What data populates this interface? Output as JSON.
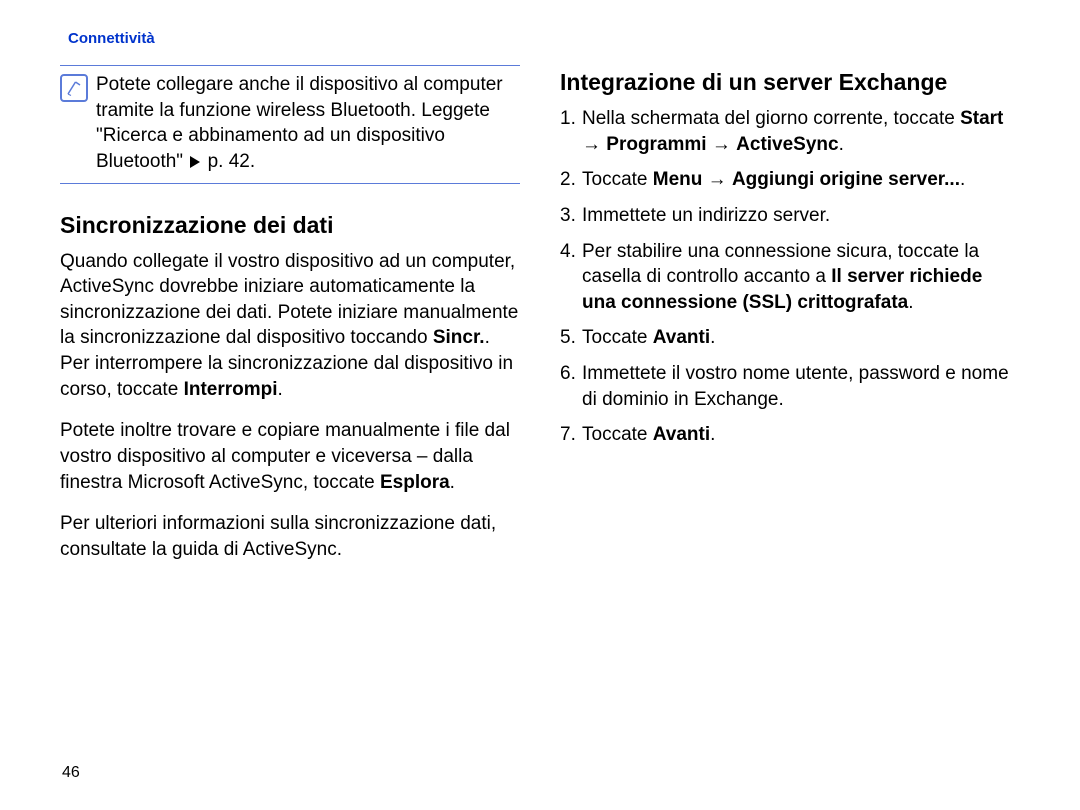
{
  "header": "Connettività",
  "note": {
    "text_before": "Potete collegare anche il dispositivo al computer tramite la funzione wireless Bluetooth. Leggete \"Ricerca e abbinamento ad un dispositivo Bluetooth\" ",
    "page_ref": " p. 42."
  },
  "left": {
    "heading": "Sincronizzazione dei dati",
    "p1_a": "Quando collegate il vostro dispositivo ad un computer, ActiveSync dovrebbe iniziare automaticamente la sincronizzazione dei dati. Potete iniziare manualmente la sincronizzazione dal dispositivo toccando ",
    "p1_b1": "Sincr.",
    "p1_c": ". Per interrompere la sincronizzazione dal dispositivo in corso, toccate ",
    "p1_b2": "Interrompi",
    "p1_d": ".",
    "p2_a": "Potete inoltre trovare e copiare manualmente i file dal vostro dispositivo al computer e viceversa – dalla finestra Microsoft ActiveSync, toccate ",
    "p2_b": "Esplora",
    "p2_c": ".",
    "p3": "Per ulteriori informazioni sulla sincronizzazione dati, consultate la guida di ActiveSync."
  },
  "right": {
    "heading": "Integrazione di un server Exchange",
    "items": [
      {
        "pre": "Nella schermata del giorno corrente, toccate ",
        "b1": "Start",
        "arr1": " → ",
        "b2": "Programmi",
        "arr2": " → ",
        "b3": "ActiveSync",
        "post": "."
      },
      {
        "pre": "Toccate ",
        "b1": "Menu",
        "arr1": " → ",
        "b2": "Aggiungi origine server...",
        "post": "."
      },
      {
        "plain": "Immettete un indirizzo server."
      },
      {
        "pre": "Per stabilire una connessione sicura, toccate la casella di controllo accanto a ",
        "b1": "Il server richiede una connessione (SSL) crittografata",
        "post": "."
      },
      {
        "pre": "Toccate ",
        "b1": "Avanti",
        "post": "."
      },
      {
        "plain": "Immettete il vostro nome utente, password e nome di dominio in Exchange."
      },
      {
        "pre": "Toccate ",
        "b1": "Avanti",
        "post": "."
      }
    ]
  },
  "pagenum": "46"
}
